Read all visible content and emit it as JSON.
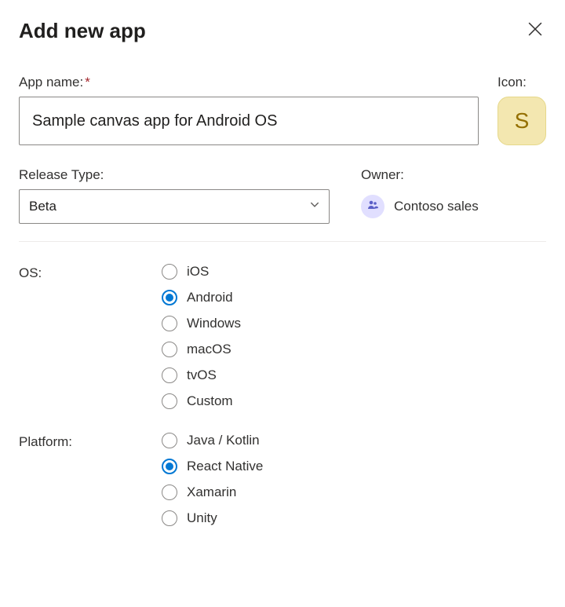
{
  "dialog": {
    "title": "Add new app"
  },
  "appName": {
    "label": "App name:",
    "required": "*",
    "value": "Sample canvas app for Android OS"
  },
  "icon": {
    "label": "Icon:",
    "letter": "S"
  },
  "releaseType": {
    "label": "Release Type:",
    "value": "Beta"
  },
  "owner": {
    "label": "Owner:",
    "name": "Contoso sales"
  },
  "os": {
    "label": "OS:",
    "options": [
      "iOS",
      "Android",
      "Windows",
      "macOS",
      "tvOS",
      "Custom"
    ],
    "selected": "Android"
  },
  "platform": {
    "label": "Platform:",
    "options": [
      "Java / Kotlin",
      "React Native",
      "Xamarin",
      "Unity"
    ],
    "selected": "React Native"
  }
}
